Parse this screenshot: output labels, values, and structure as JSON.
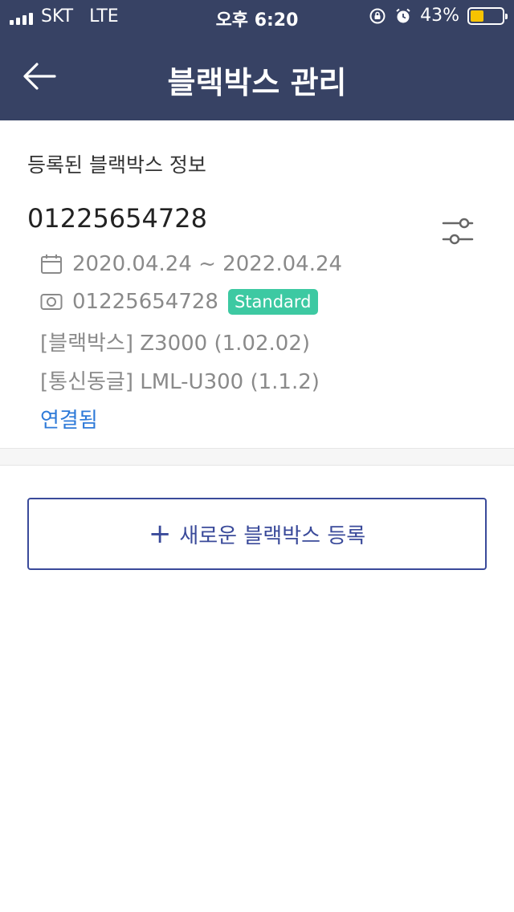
{
  "status_bar": {
    "carrier": "SKT",
    "network": "LTE",
    "time": "오후 6:20",
    "battery_percent": "43%",
    "battery_level": 0.43,
    "battery_color": "#f7c300",
    "icons": [
      "signal-icon",
      "rotation-lock-icon",
      "alarm-icon",
      "battery-icon"
    ]
  },
  "header": {
    "title": "블랙박스 관리",
    "back_icon": "back-arrow-icon",
    "background": "#374264"
  },
  "registered": {
    "section_title": "등록된 블랙박스 정보",
    "device_id": "01225654728",
    "settings_icon": "sliders-icon",
    "period": "2020.04.24 ~ 2022.04.24",
    "serial": "01225654728",
    "plan_badge": "Standard",
    "model": "[블랙박스] Z3000 (1.02.02)",
    "dongle": "[통신동글] LML-U300 (1.1.2)",
    "status": "연결됨",
    "status_color": "#2e7ad8",
    "badge_color": "#3dc9a2"
  },
  "actions": {
    "register_plus": "+",
    "register_label": "새로운 블랙박스 등록",
    "accent": "#3a4a9a"
  }
}
